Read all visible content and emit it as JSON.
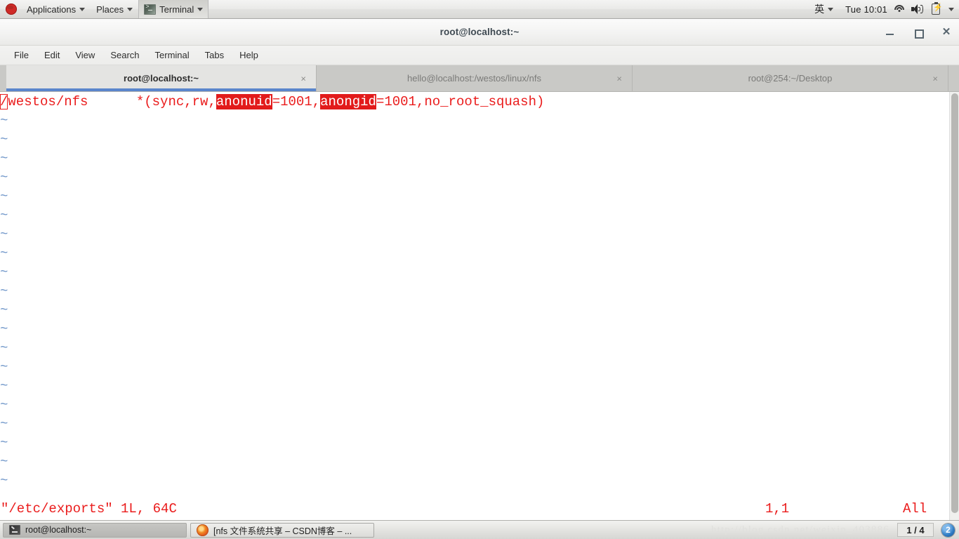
{
  "top_panel": {
    "logo_icon": "redhat-logo-icon",
    "menus": [
      {
        "label": "Applications",
        "has_caret": true
      },
      {
        "label": "Places",
        "has_caret": true
      }
    ],
    "active_app": {
      "label": "Terminal",
      "icon": "terminal-icon",
      "has_caret": true
    },
    "input_method": {
      "label": "英",
      "has_caret": true
    },
    "clock": "Tue 10:01",
    "indicators": [
      "wifi-icon",
      "volume-icon",
      "battery-icon",
      "chevron-down-icon"
    ]
  },
  "window": {
    "title": "root@localhost:~",
    "controls": {
      "minimize": "–",
      "maximize": "□",
      "close": "✕"
    },
    "menubar": [
      "File",
      "Edit",
      "View",
      "Search",
      "Terminal",
      "Tabs",
      "Help"
    ],
    "tabs": [
      {
        "label": "root@localhost:~",
        "active": true,
        "close": "×"
      },
      {
        "label": "hello@localhost:/westos/linux/nfs",
        "active": false,
        "close": "×"
      },
      {
        "label": "root@254:~/Desktop",
        "active": false,
        "close": "×"
      }
    ]
  },
  "terminal": {
    "editor": "vim",
    "content_line": {
      "cursor_char": "/",
      "seg_before_hl1": "westos/nfs      *(sync,rw,",
      "hl1": "anonuid",
      "seg_mid": "=1001,",
      "hl2": "anongid",
      "seg_after": "=1001,no_root_squash)"
    },
    "full_line": "/westos/nfs      *(sync,rw,anonuid=1001,anongid=1001,no_root_squash)",
    "empty_marker": "~",
    "empty_marker_count": 20,
    "status": {
      "file": "\"/etc/exports\" 1L, 64C",
      "position": "1,1",
      "percent": "All"
    },
    "colors": {
      "text": "#ea1c1c",
      "highlight_bg": "#e21b1b",
      "highlight_fg": "#ffffff",
      "tilde": "#6f96c9",
      "background": "#ffffff"
    }
  },
  "taskbar": {
    "buttons": [
      {
        "label": "root@localhost:~",
        "icon": "terminal-icon",
        "active": true
      },
      {
        "label": "[nfs 文件系统共享 – CSDN博客 – ...",
        "icon": "firefox-icon",
        "active": false
      }
    ],
    "watermark": "http://blog.csdn.net/weixin_403886",
    "workspace": "1 / 4",
    "notification_count": "2"
  }
}
